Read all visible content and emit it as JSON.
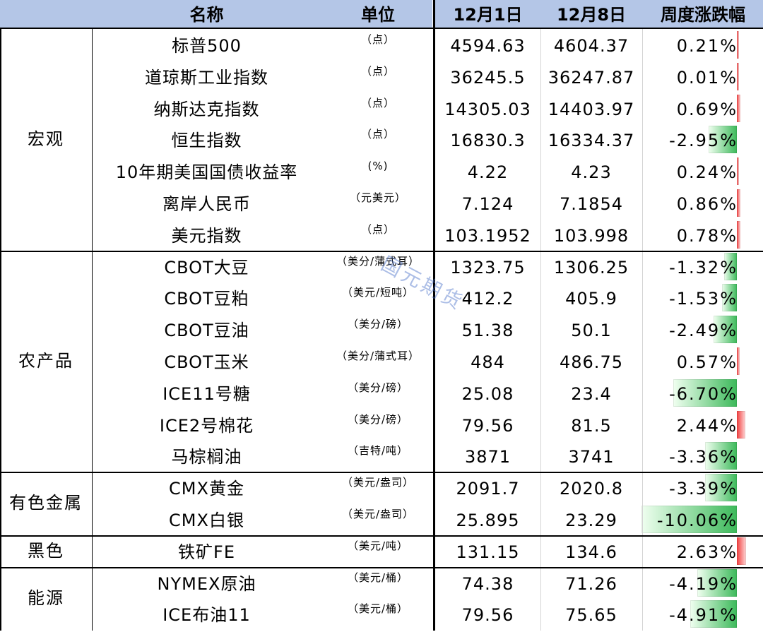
{
  "headers": {
    "name": "名称",
    "unit": "单位",
    "date1": "12月1日",
    "date2": "12月8日",
    "change": "周度涨跌幅"
  },
  "watermark": "国元期货",
  "colors": {
    "header_bg": "#b4c6e7",
    "up": "#f03c3c",
    "down": "#3cb95a"
  },
  "bar_scale_max_pct": 10.06,
  "categories": [
    {
      "label": "宏观",
      "rows": [
        {
          "name": "标普500",
          "unit": "（点）",
          "v1": "4594.63",
          "v2": "4604.37",
          "change_text": "0.21%",
          "change": 0.21
        },
        {
          "name": "道琼斯工业指数",
          "unit": "（点）",
          "v1": "36245.5",
          "v2": "36247.87",
          "change_text": "0.01%",
          "change": 0.01
        },
        {
          "name": "纳斯达克指数",
          "unit": "（点）",
          "v1": "14305.03",
          "v2": "14403.97",
          "change_text": "0.69%",
          "change": 0.69
        },
        {
          "name": "恒生指数",
          "unit": "（点）",
          "v1": "16830.3",
          "v2": "16334.37",
          "change_text": "-2.95%",
          "change": -2.95
        },
        {
          "name": "10年期美国国债收益率",
          "unit": "(%)",
          "v1": "4.22",
          "v2": "4.23",
          "change_text": "0.24%",
          "change": 0.24
        },
        {
          "name": "离岸人民币",
          "unit": "（元美元）",
          "v1": "7.124",
          "v2": "7.1854",
          "change_text": "0.86%",
          "change": 0.86
        },
        {
          "name": "美元指数",
          "unit": "（点）",
          "v1": "103.1952",
          "v2": "103.998",
          "change_text": "0.78%",
          "change": 0.78
        }
      ]
    },
    {
      "label": "农产品",
      "rows": [
        {
          "name": "CBOT大豆",
          "unit": "（美分/蒲式耳）",
          "v1": "1323.75",
          "v2": "1306.25",
          "change_text": "-1.32%",
          "change": -1.32
        },
        {
          "name": "CBOT豆粕",
          "unit": "（美元/短吨）",
          "v1": "412.2",
          "v2": "405.9",
          "change_text": "-1.53%",
          "change": -1.53
        },
        {
          "name": "CBOT豆油",
          "unit": "（美分/磅）",
          "v1": "51.38",
          "v2": "50.1",
          "change_text": "-2.49%",
          "change": -2.49
        },
        {
          "name": "CBOT玉米",
          "unit": "（美分/蒲式耳）",
          "v1": "484",
          "v2": "486.75",
          "change_text": "0.57%",
          "change": 0.57
        },
        {
          "name": "ICE11号糖",
          "unit": "（美分/磅）",
          "v1": "25.08",
          "v2": "23.4",
          "change_text": "-6.70%",
          "change": -6.7
        },
        {
          "name": "ICE2号棉花",
          "unit": "（美分/磅）",
          "v1": "79.56",
          "v2": "81.5",
          "change_text": "2.44%",
          "change": 2.44
        },
        {
          "name": "马棕榈油",
          "unit": "（吉特/吨）",
          "v1": "3871",
          "v2": "3741",
          "change_text": "-3.36%",
          "change": -3.36
        }
      ]
    },
    {
      "label": "有色金属",
      "rows": [
        {
          "name": "CMX黄金",
          "unit": "（美元/盎司）",
          "v1": "2091.7",
          "v2": "2020.8",
          "change_text": "-3.39%",
          "change": -3.39
        },
        {
          "name": "CMX白银",
          "unit": "（美元/盎司）",
          "v1": "25.895",
          "v2": "23.29",
          "change_text": "-10.06%",
          "change": -10.06
        }
      ]
    },
    {
      "label": "黑色",
      "rows": [
        {
          "name": "铁矿FE",
          "unit": "（美元/吨）",
          "v1": "131.15",
          "v2": "134.6",
          "change_text": "2.63%",
          "change": 2.63
        }
      ]
    },
    {
      "label": "能源",
      "rows": [
        {
          "name": "NYMEX原油",
          "unit": "（美元/桶）",
          "v1": "74.38",
          "v2": "71.26",
          "change_text": "-4.19%",
          "change": -4.19
        },
        {
          "name": "ICE布油11",
          "unit": "（美元/桶）",
          "v1": "79.56",
          "v2": "75.65",
          "change_text": "-4.91%",
          "change": -4.91
        }
      ]
    }
  ]
}
